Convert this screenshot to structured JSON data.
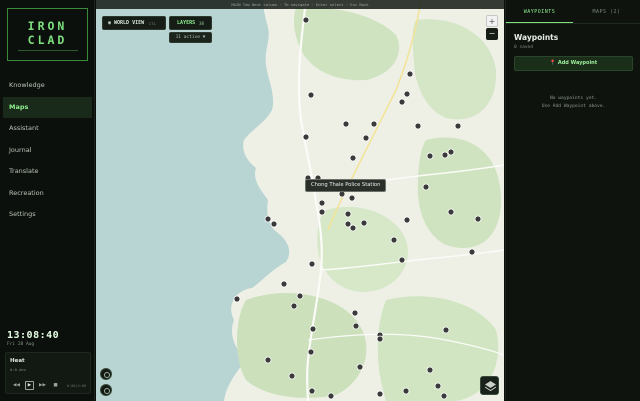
{
  "app": {
    "logo_line1": "IRON",
    "logo_line2": "CLAD"
  },
  "sidebar": {
    "items": [
      {
        "label": "Knowledge",
        "active": false
      },
      {
        "label": "Maps",
        "active": true
      },
      {
        "label": "Assistant",
        "active": false
      },
      {
        "label": "Journal",
        "active": false
      },
      {
        "label": "Translate",
        "active": false
      },
      {
        "label": "Recreation",
        "active": false
      },
      {
        "label": "Settings",
        "active": false
      }
    ],
    "clock": "13:08:40",
    "date": "Fri 28 Aug"
  },
  "player": {
    "title": "Heat",
    "subtitle": "0:0.des",
    "volume": "0:00/4:00"
  },
  "map": {
    "top_hint": "MAIN  Tab Next column  ·  Tb navigate  ·  Enter select  ·  Esc Back",
    "world_view_label": "WORLD VIEW",
    "world_view_key": "CTL",
    "layers_label": "LAYERS",
    "layers_count": "38",
    "active_label": "11 active ▼",
    "tooltip": "Chong Thale Police Station",
    "zoom_in": "+",
    "zoom_out": "−",
    "colors": {
      "water": "#b9d5d3",
      "land": "#eef0e6",
      "forest": "#cfe3c0",
      "road": "#fbfbf8",
      "road_major": "#f3e39a"
    }
  },
  "panel": {
    "tabs": [
      {
        "label": "WAYPOINTS",
        "active": true
      },
      {
        "label": "MAPS (2)",
        "active": false
      }
    ],
    "title": "Waypoints",
    "saved": "0 saved",
    "add_button": "📍 Add Waypoint",
    "empty_line1": "No waypoints yet.",
    "empty_line2": "Use Add Waypoint above."
  }
}
